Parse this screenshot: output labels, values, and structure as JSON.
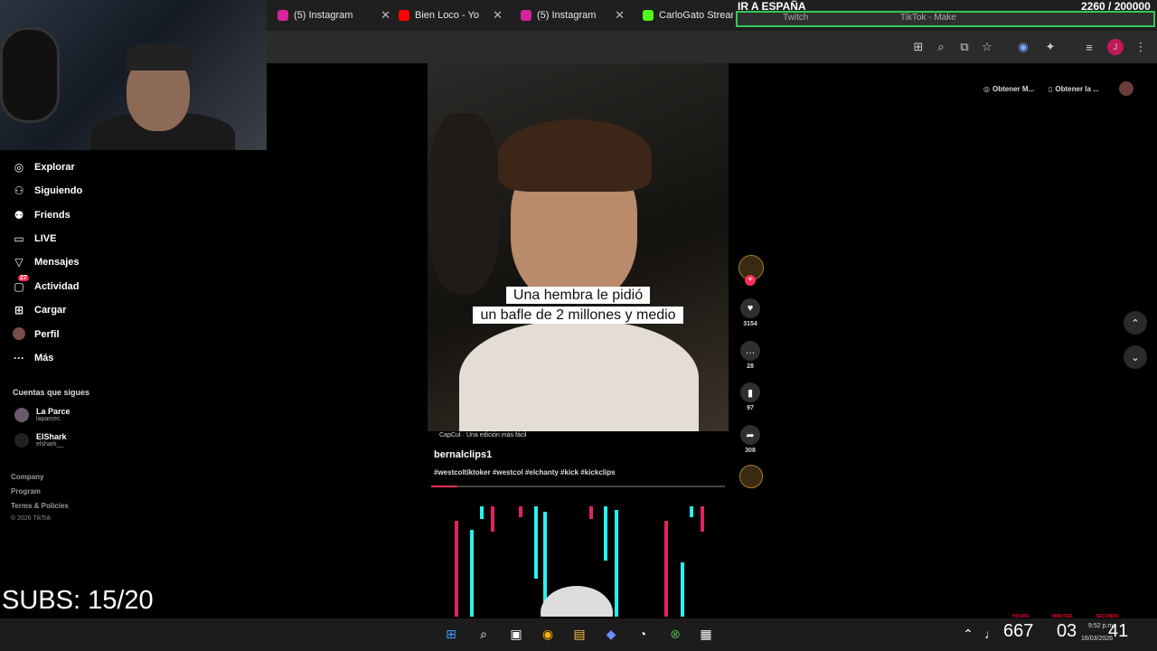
{
  "browser": {
    "tabs": [
      {
        "label": "(5) Instagram",
        "color": "#d6249f"
      },
      {
        "label": "Bien Loco - Yo",
        "color": "#ff0000"
      },
      {
        "label": "(5) Instagram",
        "color": "#d6249f"
      },
      {
        "label": "CarloGato Stream",
        "color": "#53fc18"
      }
    ],
    "close_glyph": "✕"
  },
  "overlay": {
    "goal_title": "IR A ESPAÑA",
    "goal_count": "2260 / 200000",
    "tab_twitch": "Twitch",
    "tab_tiktok": "TikTok - Make",
    "subs": "SUBS: 15/20"
  },
  "sidebar": {
    "items": [
      {
        "label": "Explorar",
        "icon": "compass-icon"
      },
      {
        "label": "Siguiendo",
        "icon": "user-follow-icon"
      },
      {
        "label": "Friends",
        "icon": "friends-icon"
      },
      {
        "label": "LIVE",
        "icon": "live-icon"
      },
      {
        "label": "Mensajes",
        "icon": "send-icon"
      },
      {
        "label": "Actividad",
        "icon": "activity-icon",
        "badge": "27"
      },
      {
        "label": "Cargar",
        "icon": "upload-icon"
      },
      {
        "label": "Perfil",
        "icon": "avatar"
      },
      {
        "label": "Más",
        "icon": "more-icon"
      }
    ],
    "following_title": "Cuentas que sigues",
    "accounts": [
      {
        "name": "La Parce",
        "handle": "laparcec"
      },
      {
        "name": "ElShark",
        "handle": "elshark__"
      }
    ],
    "footer": [
      "Company",
      "Program",
      "Terms & Policies"
    ],
    "copyright": "© 2026 TikTok"
  },
  "video": {
    "caption_line1": "Una hembra le pidió",
    "caption_line2": "un bafle de 2 millones y medio",
    "capcut": "CapCut · Una edición más fácil",
    "author": "bernalclips1",
    "tags": "#westcoltiktoker #westcol #elchanty #kick #kickclips",
    "progress": 0.09
  },
  "actions": {
    "likes": "3154",
    "comments": "28",
    "saves": "97",
    "shares": "308"
  },
  "right_panel": {
    "get_app": "Obtener M...",
    "get_app2": "Obtener la ..."
  },
  "clock": {
    "big": "667",
    "mid": "03",
    "sec": "41",
    "labels": [
      "HOURS",
      "MINUTES",
      "SECONDS"
    ],
    "time": "9:52 p.m.",
    "date": "16/03/2026"
  },
  "colors": {
    "accent": "#fe2c55",
    "teal": "#25f4ee",
    "goal_border": "#35c759"
  }
}
